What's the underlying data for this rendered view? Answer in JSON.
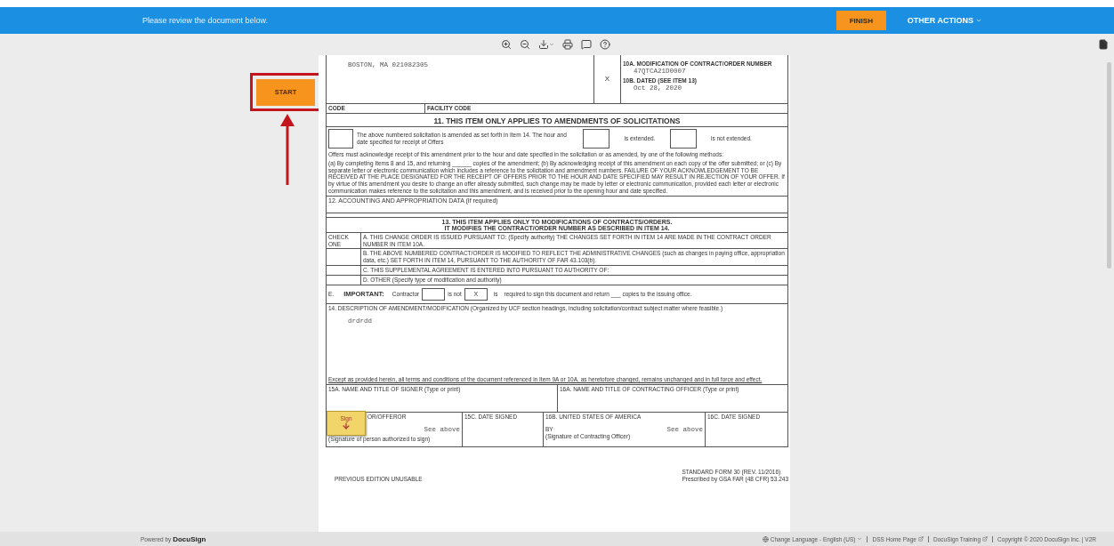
{
  "header": {
    "message": "Please review the document below.",
    "finish_button": "FINISH",
    "other_actions": "OTHER ACTIONS"
  },
  "start_button": "START",
  "document": {
    "address": "BOSTON, MA 021082305",
    "item_9_mark": "X",
    "item_10a": {
      "label": "10A. MODIFICATION OF CONTRACT/ORDER NUMBER",
      "value": "47QTCA21D0007"
    },
    "item_10b": {
      "label": "10B. DATED (SEE ITEM 13)",
      "value": "Oct 28, 2020"
    },
    "code_label": "CODE",
    "facility_code_label": "FACILITY CODE",
    "section_11": {
      "title": "11. THIS ITEM ONLY APPLIES TO AMENDMENTS OF SOLICITATIONS",
      "text": "The above numbered solicitation is amended as set forth in Item 14.  The hour and date specified for receipt of Offers",
      "extended": "is extended.",
      "not_extended": "is not extended.",
      "acknowledge": "Offers must acknowledge receipt of this amendment prior to the hour and date specified in the solicitation or as amended, by one of the following methods:",
      "methods": "(a) By completing Items 8 and 15, and returning ______ copies of the amendment; (b) By acknowledging receipt of this amendment on each copy of the offer submitted; or (c) By separate letter or electronic communication which includes a reference to the solicitation and amendment numbers. FAILURE OF YOUR ACKNOWLEDGEMENT TO BE RECEIVED AT THE PLACE DESIGNATED FOR THE RECEIPT OF OFFERS PRIOR TO THE HOUR AND DATE SPECIFIED MAY RESULT IN REJECTION OF YOUR OFFER. If by virtue of this amendment you desire to change an offer already submitted, such change may be made by letter or electronic communication, provided each letter or electronic communication makes reference to the solicitation and this amendment, and is received prior to the opening hour and date specified."
    },
    "section_12": "12. ACCOUNTING AND APPROPRIATION DATA (If required)",
    "section_13": {
      "title": "13. THIS ITEM APPLIES ONLY TO MODIFICATIONS OF CONTRACTS/ORDERS.",
      "subtitle": "IT MODIFIES THE CONTRACT/ORDER NUMBER AS DESCRIBED IN ITEM 14.",
      "check_label": "CHECK ONE",
      "options": [
        "A. THIS CHANGE ORDER IS ISSUED PURSUANT TO: (Specify authority) THE CHANGES SET FORTH IN ITEM 14 ARE MADE IN THE CONTRACT ORDER NUMBER IN ITEM 10A.",
        "B. THE ABOVE NUMBERED CONTRACT/ORDER IS MODIFIED TO REFLECT THE ADMINISTRATIVE CHANGES (such as changes in paying office, appropriation data, etc.) SET FORTH IN ITEM 14, PURSUANT TO THE AUTHORITY OF FAR 43.103(b).",
        "C. THIS SUPPLEMENTAL AGREEMENT IS ENTERED INTO PURSUANT TO AUTHORITY OF:",
        "D. OTHER (Specify type of modification and authority)"
      ]
    },
    "important": {
      "letter": "E.",
      "label": "IMPORTANT:",
      "contractor": "Contractor",
      "is_not": "is not",
      "is_not_mark": "X",
      "is": "is",
      "rest": "required to sign this document and return ___ copies to the issuing office."
    },
    "section_14": {
      "label": "14. DESCRIPTION OF AMENDMENT/MODIFICATION (Organized by UCF section headings, including solicitation/contract subject matter where feasible.)",
      "value": "drdrdd",
      "footnote": "Except as provided herein, all terms and conditions of the document referenced in Item 9A or 10A, as heretofore changed, remains unchanged and in full force and effect."
    },
    "item_15a": "15A. NAME AND TITLE OF SIGNER (Type or print)",
    "item_16a": "16A. NAME AND TITLE OF CONTRACTING OFFICER (Type or print)",
    "item_15b": {
      "label": "OR/OFFEROR",
      "value": "See above",
      "caption": "(Signature of person authorized to sign)"
    },
    "item_15c": "15C. DATE SIGNED",
    "item_16b": {
      "label": "16B. UNITED STATES OF AMERICA",
      "by": "BY",
      "value": "See above",
      "caption": "(Signature of Contracting Officer)"
    },
    "item_16c": "16C. DATE SIGNED",
    "sign_tag": "Sign",
    "edition_note": "PREVIOUS EDITION UNUSABLE",
    "form_number": "STANDARD FORM 30 (REV. 11/2016)",
    "prescribed": "Prescribed by GSA FAR (48 CFR) 53.243"
  },
  "footer": {
    "powered_by": "Powered by",
    "brand": "DocuSign",
    "language": "Change Language - English (US)",
    "links": [
      "DSS Home Page",
      "DocuSign Training"
    ],
    "copyright": "Copyright © 2020 DocuSign Inc. | V2R"
  }
}
